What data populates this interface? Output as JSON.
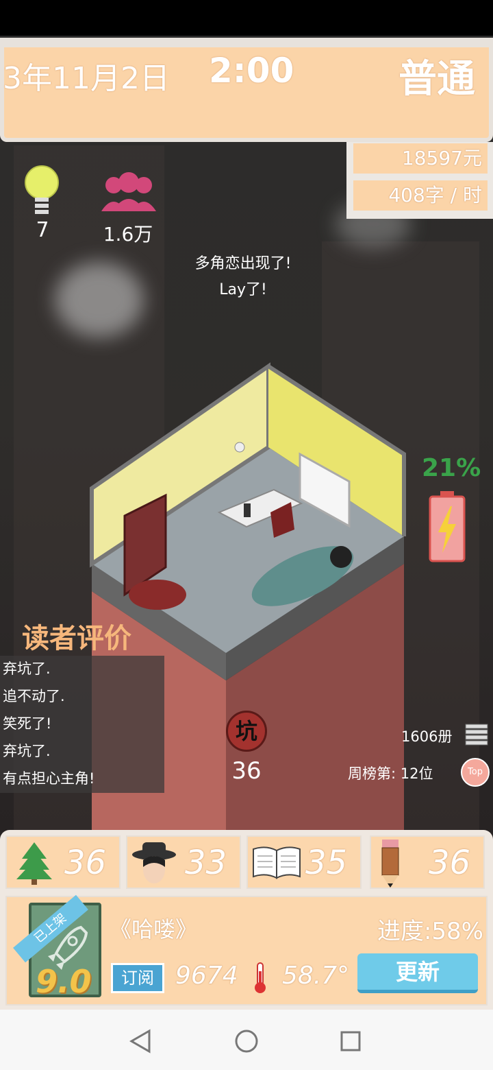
{
  "header": {
    "date": "3年11月2日",
    "time": "2:00",
    "difficulty": "普通",
    "money": "18597元",
    "speed": "408字 / 时"
  },
  "stats": {
    "ideas": "7",
    "fans": "1.6万"
  },
  "message": {
    "line1": "多角恋出现了!",
    "line2": "Lay了!"
  },
  "energy": {
    "percent": "21%",
    "level": 0.21,
    "color": "#3aa34a"
  },
  "reviews": {
    "title": "读者评价",
    "items": [
      "弃坑了.",
      "追不动了.",
      "笑死了!",
      "弃坑了.",
      "有点担心主角!"
    ]
  },
  "pit": {
    "label": "坑",
    "count": "36"
  },
  "ranking": {
    "books": "1606册",
    "weekly": "周榜第: 12位",
    "top_label": "Top"
  },
  "attributes": [
    {
      "icon": "tree-icon",
      "value": "36"
    },
    {
      "icon": "detective-hat-icon",
      "value": "33"
    },
    {
      "icon": "open-book-icon",
      "value": "35"
    },
    {
      "icon": "pencil-icon",
      "value": "36"
    }
  ],
  "novel": {
    "ribbon": "已上架",
    "score": "9.0",
    "title": "《哈喽》",
    "progress": "进度:58%",
    "subscribe_label": "订阅",
    "subscribers": "9674",
    "heat": "58.7°",
    "update_label": "更新"
  }
}
